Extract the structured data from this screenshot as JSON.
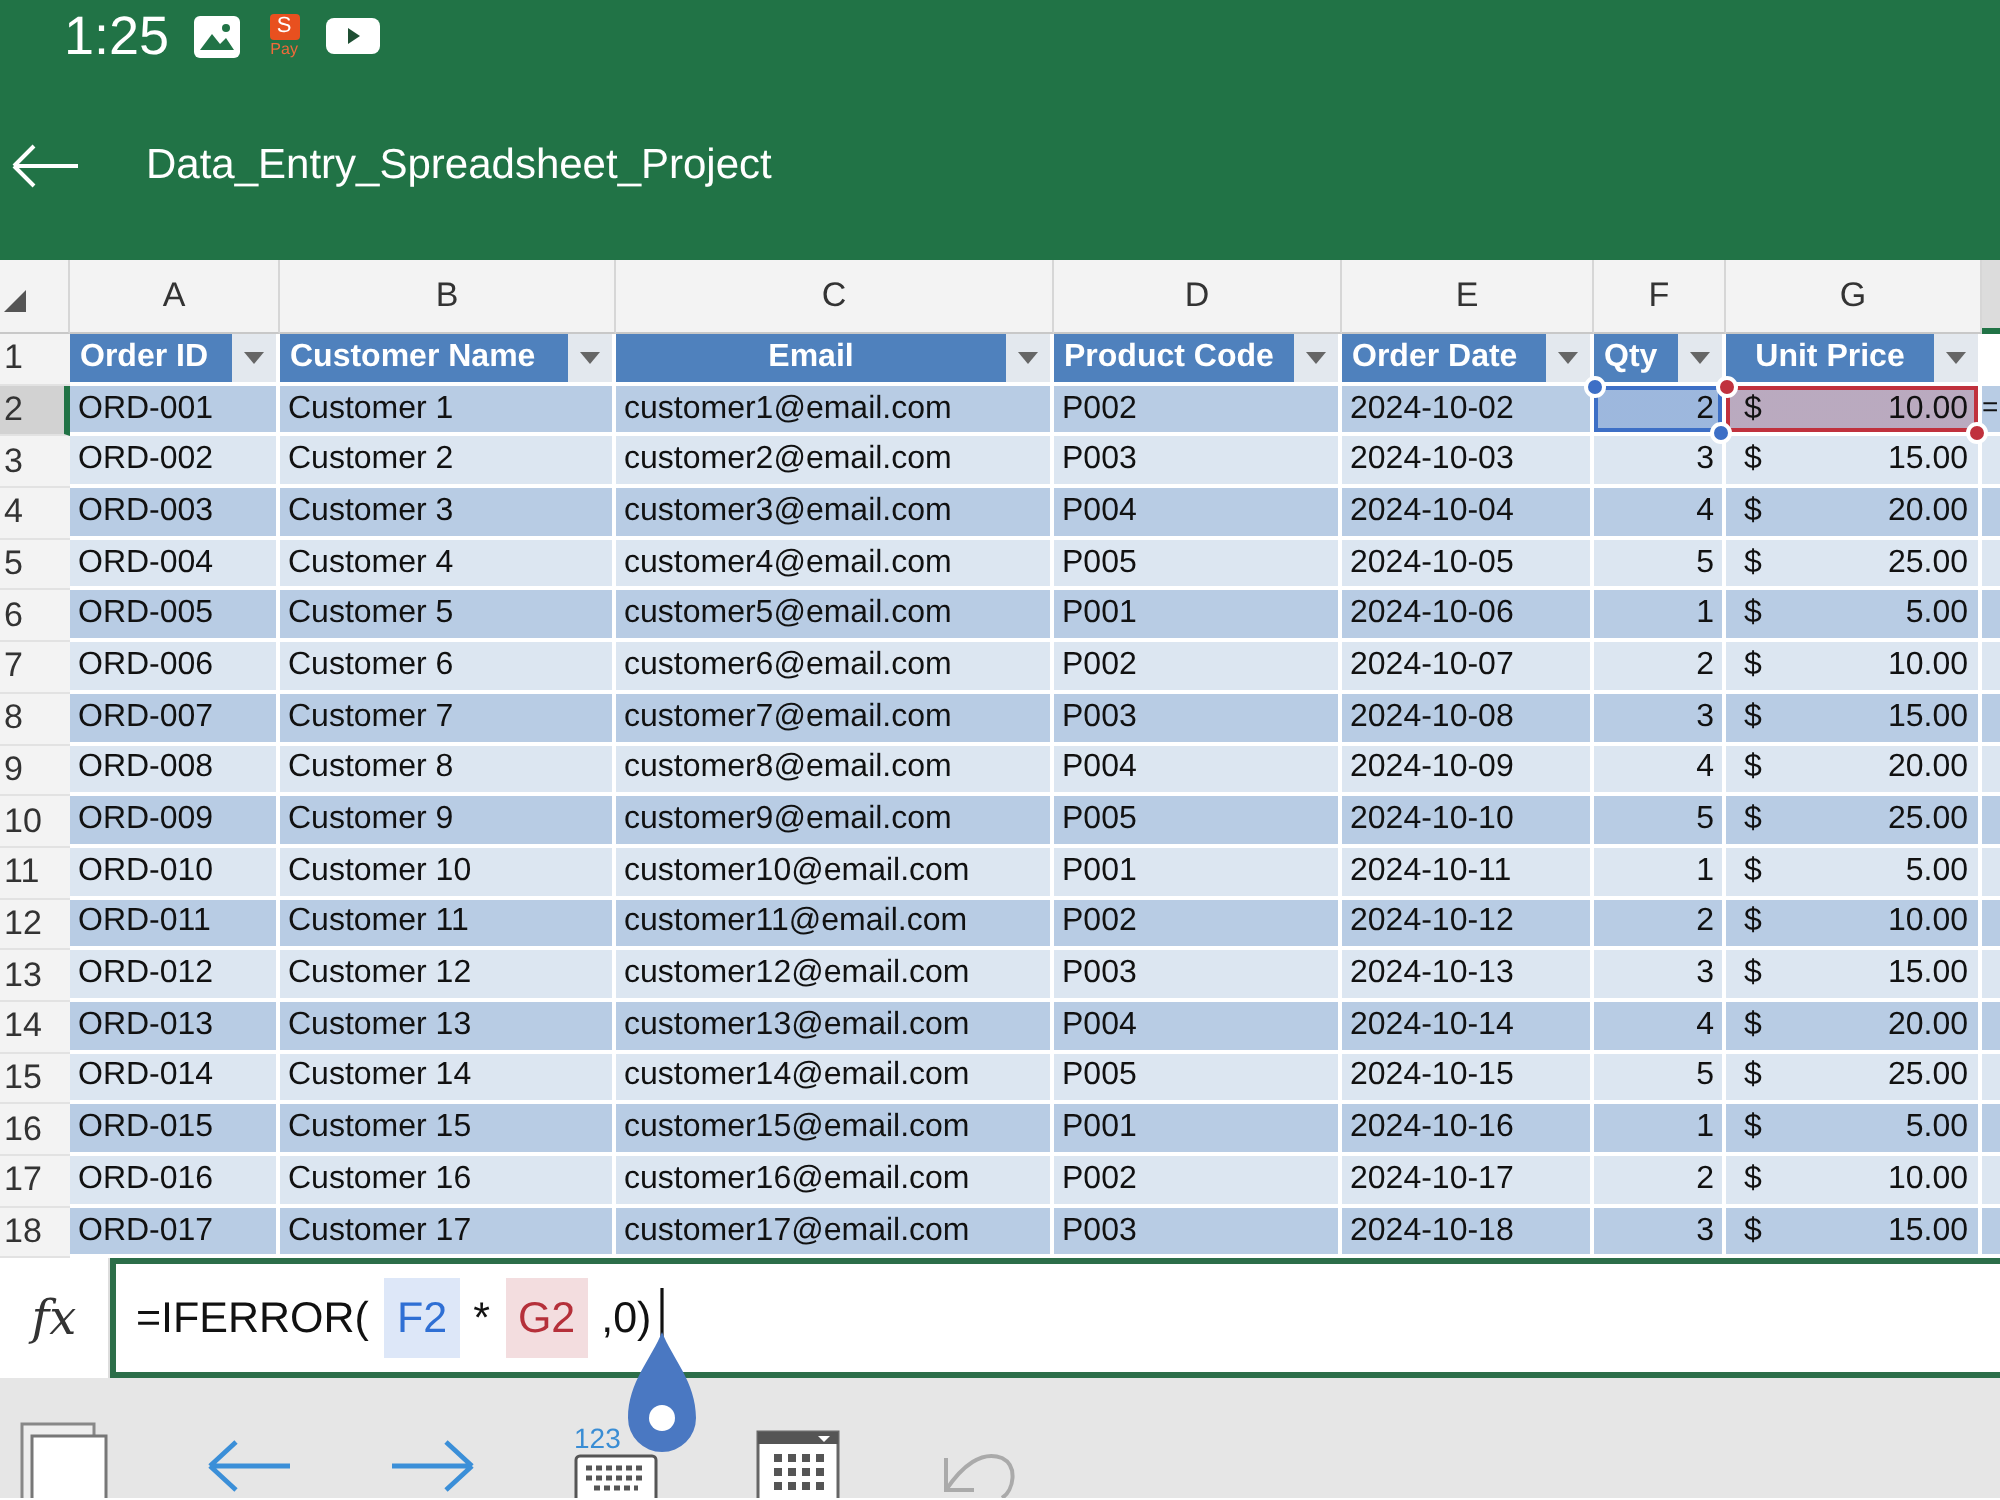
{
  "status_bar": {
    "time": "1:25",
    "app_badge": "S",
    "app_badge_caption": "Pay"
  },
  "app_bar": {
    "title": "Data_Entry_Spreadsheet_Project"
  },
  "sheet": {
    "column_letters": [
      {
        "label": "A",
        "selected": false
      },
      {
        "label": "B",
        "selected": false
      },
      {
        "label": "C",
        "selected": false
      },
      {
        "label": "D",
        "selected": false
      },
      {
        "label": "E",
        "selected": false
      },
      {
        "label": "F",
        "selected": false
      },
      {
        "label": "G",
        "selected": false
      }
    ],
    "partial_column": {
      "selected": true
    },
    "header_row": {
      "number": "1",
      "selected": false
    },
    "columns": [
      {
        "label": "Order ID"
      },
      {
        "label": "Customer Name"
      },
      {
        "label": "Email"
      },
      {
        "label": "Product Code"
      },
      {
        "label": "Order Date"
      },
      {
        "label": "Qty"
      },
      {
        "label": "Unit Price"
      }
    ],
    "rows": [
      {
        "number": "2",
        "selected": true,
        "order_id": "ORD-001",
        "customer_name": "Customer 1",
        "email": "customer1@email.com",
        "product_code": "P002",
        "order_date": "2024-10-02",
        "qty": "2",
        "qty_highlight": {
          "color": "#3d6fc6"
        },
        "currency": "$",
        "unit_price": "10.00",
        "price_highlight": {
          "color": "#c0313d"
        },
        "column_8": "="
      },
      {
        "number": "3",
        "selected": false,
        "order_id": "ORD-002",
        "customer_name": "Customer 2",
        "email": "customer2@email.com",
        "product_code": "P003",
        "order_date": "2024-10-03",
        "qty": "3",
        "currency": "$",
        "unit_price": "15.00"
      },
      {
        "number": "4",
        "selected": false,
        "order_id": "ORD-003",
        "customer_name": "Customer 3",
        "email": "customer3@email.com",
        "product_code": "P004",
        "order_date": "2024-10-04",
        "qty": "4",
        "currency": "$",
        "unit_price": "20.00"
      },
      {
        "number": "5",
        "selected": false,
        "order_id": "ORD-004",
        "customer_name": "Customer 4",
        "email": "customer4@email.com",
        "product_code": "P005",
        "order_date": "2024-10-05",
        "qty": "5",
        "currency": "$",
        "unit_price": "25.00"
      },
      {
        "number": "6",
        "selected": false,
        "order_id": "ORD-005",
        "customer_name": "Customer 5",
        "email": "customer5@email.com",
        "product_code": "P001",
        "order_date": "2024-10-06",
        "qty": "1",
        "currency": "$",
        "unit_price": "5.00"
      },
      {
        "number": "7",
        "selected": false,
        "order_id": "ORD-006",
        "customer_name": "Customer 6",
        "email": "customer6@email.com",
        "product_code": "P002",
        "order_date": "2024-10-07",
        "qty": "2",
        "currency": "$",
        "unit_price": "10.00"
      },
      {
        "number": "8",
        "selected": false,
        "order_id": "ORD-007",
        "customer_name": "Customer 7",
        "email": "customer7@email.com",
        "product_code": "P003",
        "order_date": "2024-10-08",
        "qty": "3",
        "currency": "$",
        "unit_price": "15.00"
      },
      {
        "number": "9",
        "selected": false,
        "order_id": "ORD-008",
        "customer_name": "Customer 8",
        "email": "customer8@email.com",
        "product_code": "P004",
        "order_date": "2024-10-09",
        "qty": "4",
        "currency": "$",
        "unit_price": "20.00"
      },
      {
        "number": "10",
        "selected": false,
        "order_id": "ORD-009",
        "customer_name": "Customer 9",
        "email": "customer9@email.com",
        "product_code": "P005",
        "order_date": "2024-10-10",
        "qty": "5",
        "currency": "$",
        "unit_price": "25.00"
      },
      {
        "number": "11",
        "selected": false,
        "order_id": "ORD-010",
        "customer_name": "Customer 10",
        "email": "customer10@email.com",
        "product_code": "P001",
        "order_date": "2024-10-11",
        "qty": "1",
        "currency": "$",
        "unit_price": "5.00"
      },
      {
        "number": "12",
        "selected": false,
        "order_id": "ORD-011",
        "customer_name": "Customer 11",
        "email": "customer11@email.com",
        "product_code": "P002",
        "order_date": "2024-10-12",
        "qty": "2",
        "currency": "$",
        "unit_price": "10.00"
      },
      {
        "number": "13",
        "selected": false,
        "order_id": "ORD-012",
        "customer_name": "Customer 12",
        "email": "customer12@email.com",
        "product_code": "P003",
        "order_date": "2024-10-13",
        "qty": "3",
        "currency": "$",
        "unit_price": "15.00"
      },
      {
        "number": "14",
        "selected": false,
        "order_id": "ORD-013",
        "customer_name": "Customer 13",
        "email": "customer13@email.com",
        "product_code": "P004",
        "order_date": "2024-10-14",
        "qty": "4",
        "currency": "$",
        "unit_price": "20.00"
      },
      {
        "number": "15",
        "selected": false,
        "order_id": "ORD-014",
        "customer_name": "Customer 14",
        "email": "customer14@email.com",
        "product_code": "P005",
        "order_date": "2024-10-15",
        "qty": "5",
        "currency": "$",
        "unit_price": "25.00"
      },
      {
        "number": "16",
        "selected": false,
        "order_id": "ORD-015",
        "customer_name": "Customer 15",
        "email": "customer15@email.com",
        "product_code": "P001",
        "order_date": "2024-10-16",
        "qty": "1",
        "currency": "$",
        "unit_price": "5.00"
      },
      {
        "number": "17",
        "selected": false,
        "order_id": "ORD-016",
        "customer_name": "Customer 16",
        "email": "customer16@email.com",
        "product_code": "P002",
        "order_date": "2024-10-17",
        "qty": "2",
        "currency": "$",
        "unit_price": "10.00"
      },
      {
        "number": "18",
        "selected": false,
        "order_id": "ORD-017",
        "customer_name": "Customer 17",
        "email": "customer17@email.com",
        "product_code": "P003",
        "order_date": "2024-10-18",
        "qty": "3",
        "currency": "$",
        "unit_price": "15.00"
      }
    ]
  },
  "formula_bar": {
    "label": "fx",
    "parts": [
      {
        "kind": "text",
        "text": "=IFERROR("
      },
      {
        "kind": "ref",
        "text": "F2",
        "color": "#2f6fd4"
      },
      {
        "kind": "text",
        "text": "*"
      },
      {
        "kind": "ref",
        "text": "G2",
        "color": "#b5303a"
      },
      {
        "kind": "text",
        "text": ",0)"
      }
    ]
  },
  "toolbar": {
    "keyboard_label": "123"
  }
}
